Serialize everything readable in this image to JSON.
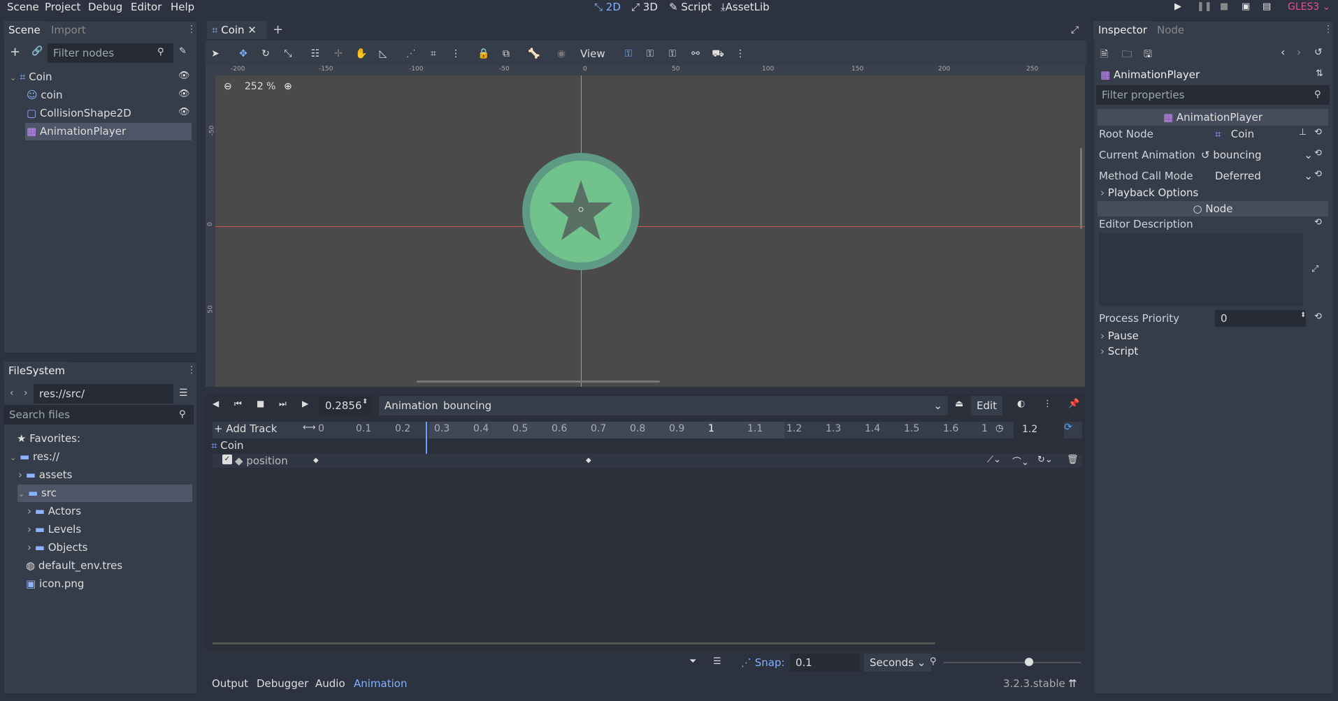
{
  "menu": [
    "Scene",
    "Project",
    "Debug",
    "Editor",
    "Help"
  ],
  "workspaces": [
    "2D",
    "3D",
    "Script",
    "AssetLib"
  ],
  "renderer": "GLES3",
  "scene_dock": {
    "tabs": [
      "Scene",
      "Import"
    ],
    "filter_placeholder": "Filter nodes",
    "nodes": [
      "Coin",
      "coin",
      "CollisionShape2D",
      "AnimationPlayer"
    ]
  },
  "filesystem": {
    "tab": "FileSystem",
    "path": "res://src/",
    "search_placeholder": "Search files",
    "items": [
      "Favorites:",
      "res://",
      "assets",
      "src",
      "Actors",
      "Levels",
      "Objects",
      "default_env.tres",
      "icon.png"
    ]
  },
  "editor_tab": {
    "label": "Coin"
  },
  "viewport": {
    "zoom": "252 %",
    "view_label": "View",
    "ruler_labels": [
      "-200",
      "-150",
      "-100",
      "-50",
      "0",
      "50",
      "100",
      "150",
      "200",
      "250"
    ],
    "ruler_v_labels": [
      "-50",
      "0",
      "50"
    ]
  },
  "animation": {
    "time": "0.2856",
    "label": "Animation",
    "current": "bouncing",
    "edit": "Edit",
    "add_track": "Add Track",
    "ticks": [
      "0",
      "0.1",
      "0.2",
      "0.3",
      "0.4",
      "0.5",
      "0.6",
      "0.7",
      "0.8",
      "0.9",
      "1",
      "1.1",
      "1.2",
      "1.3",
      "1.4",
      "1.5",
      "1.6",
      "1"
    ],
    "length": "1.2",
    "track_group": "Coin",
    "track_name": "position",
    "snap_label": "Snap:",
    "snap_value": "0.1",
    "snap_unit": "Seconds"
  },
  "bottom_tabs": [
    "Output",
    "Debugger",
    "Audio",
    "Animation"
  ],
  "version": "3.2.3.stable",
  "inspector": {
    "tabs": [
      "Inspector",
      "Node"
    ],
    "node_name": "AnimationPlayer",
    "filter_placeholder": "Filter properties",
    "header": "AnimationPlayer",
    "root_node_label": "Root Node",
    "root_node_value": "Coin",
    "current_anim_label": "Current Animation",
    "current_anim_value": "bouncing",
    "method_label": "Method Call Mode",
    "method_value": "Deferred",
    "playback_options": "Playback Options",
    "node_section": "Node",
    "editor_desc": "Editor Description",
    "priority_label": "Process Priority",
    "priority_value": "0",
    "pause": "Pause",
    "script": "Script"
  }
}
